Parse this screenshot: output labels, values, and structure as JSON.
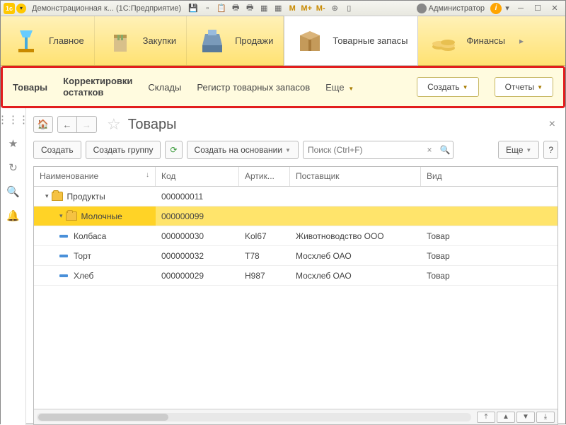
{
  "titlebar": {
    "app_badge": "1c",
    "title": "Демонстрационная к... (1С:Предприятие)",
    "user_label": "Администратор",
    "m_buttons": [
      "M",
      "M+",
      "M-"
    ]
  },
  "mainnav": [
    {
      "label": "Главное",
      "icon": "lamp"
    },
    {
      "label": "Закупки",
      "icon": "bag"
    },
    {
      "label": "Продажи",
      "icon": "cashreg"
    },
    {
      "label": "Товарные запасы",
      "icon": "box",
      "active": true
    },
    {
      "label": "Финансы",
      "icon": "coins"
    }
  ],
  "subnav": {
    "links": [
      "Товары",
      "Корректировки остатков",
      "Склады",
      "Регистр товарных запасов"
    ],
    "more": "Еще",
    "create": "Создать",
    "reports": "Отчеты"
  },
  "page": {
    "title": "Товары"
  },
  "toolbar": {
    "create": "Создать",
    "create_group": "Создать группу",
    "create_based": "Создать на основании",
    "search_placeholder": "Поиск (Ctrl+F)",
    "more": "Еще",
    "help": "?"
  },
  "columns": {
    "name": "Наименование",
    "code": "Код",
    "article": "Артик...",
    "supplier": "Поставщик",
    "kind": "Вид"
  },
  "rows": [
    {
      "type": "folder",
      "level": 0,
      "expanded": true,
      "name": "Продукты",
      "code": "000000011",
      "article": "",
      "supplier": "",
      "kind": ""
    },
    {
      "type": "folder",
      "level": 1,
      "expanded": true,
      "name": "Молочные",
      "code": "000000099",
      "article": "",
      "supplier": "",
      "kind": "",
      "selected": true
    },
    {
      "type": "item",
      "level": 1,
      "name": "Колбаса",
      "code": "000000030",
      "article": "Kol67",
      "supplier": "Животноводство ООО",
      "kind": "Товар"
    },
    {
      "type": "item",
      "level": 1,
      "name": "Торт",
      "code": "000000032",
      "article": "T78",
      "supplier": "Мосхлеб ОАО",
      "kind": "Товар"
    },
    {
      "type": "item",
      "level": 1,
      "name": "Хлеб",
      "code": "000000029",
      "article": "H987",
      "supplier": "Мосхлеб ОАО",
      "kind": "Товар"
    }
  ]
}
